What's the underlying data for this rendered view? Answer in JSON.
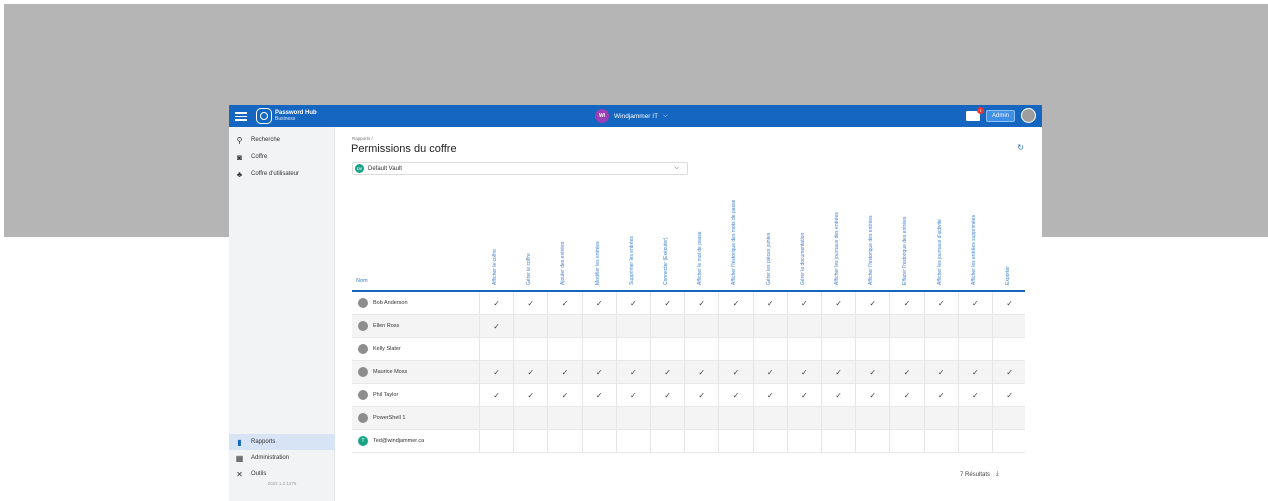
{
  "app": {
    "logo_title": "Password Hub",
    "logo_subtitle": "Business",
    "workspace": "Windjammer IT",
    "workspace_initials": "WI",
    "mail_badge": "1",
    "admin_label": "Admin",
    "brand_color": "#1566c0"
  },
  "sidebar": {
    "top_items": [
      {
        "label": "Recherche",
        "icon": "search-icon"
      },
      {
        "label": "Coffre",
        "icon": "vault-icon"
      },
      {
        "label": "Coffre d'utilisateur",
        "icon": "user-vault-icon"
      }
    ],
    "bottom_items": [
      {
        "label": "Rapports",
        "icon": "reports-icon",
        "active": true
      },
      {
        "label": "Administration",
        "icon": "admin-icon"
      },
      {
        "label": "Outils",
        "icon": "tools-icon"
      }
    ],
    "version": "2022.1.2.1275"
  },
  "page": {
    "breadcrumb": "Rapports  /",
    "title": "Permissions du coffre",
    "vault_select": "Default Vault",
    "vault_initials": "DV",
    "results": "7 Résultats"
  },
  "table": {
    "name_header": "Nom",
    "columns": [
      "Afficher le coffre",
      "Gérer le coffre",
      "Ajouter des entrées",
      "Modifier les entrées",
      "Supprimer les entrées",
      "Connecter (Exécuter)",
      "Afficher le mot de passe",
      "Afficher l'historique des mots de passe",
      "Gérer les pièces jointes",
      "Gérer la documentation",
      "Afficher les journaux des entrées",
      "Afficher l'historique des entrées",
      "Effacer l'historique des entrées",
      "Afficher les journaux d'activité",
      "Afficher les entrées supprimées",
      "Exporter"
    ],
    "check_glyph": "✓",
    "rows": [
      {
        "name": "Bob Anderson",
        "perms": [
          1,
          1,
          1,
          1,
          1,
          1,
          1,
          1,
          1,
          1,
          1,
          1,
          1,
          1,
          1,
          1
        ]
      },
      {
        "name": "Ellen Ross",
        "perms": [
          1,
          0,
          0,
          0,
          0,
          0,
          0,
          0,
          0,
          0,
          0,
          0,
          0,
          0,
          0,
          0
        ]
      },
      {
        "name": "Kelly Slater",
        "perms": [
          0,
          0,
          0,
          0,
          0,
          0,
          0,
          0,
          0,
          0,
          0,
          0,
          0,
          0,
          0,
          0
        ]
      },
      {
        "name": "Maurice Moss",
        "perms": [
          1,
          1,
          1,
          1,
          1,
          1,
          1,
          1,
          1,
          1,
          1,
          1,
          1,
          1,
          1,
          1
        ]
      },
      {
        "name": "Phil Taylor",
        "perms": [
          1,
          1,
          1,
          1,
          1,
          1,
          1,
          1,
          1,
          1,
          1,
          1,
          1,
          1,
          1,
          1
        ]
      },
      {
        "name": "PowerShell 1",
        "perms": [
          0,
          0,
          0,
          0,
          0,
          0,
          0,
          0,
          0,
          0,
          0,
          0,
          0,
          0,
          0,
          0
        ]
      },
      {
        "name": "Ted@windjammer.ca",
        "initial": "T",
        "perms": [
          0,
          0,
          0,
          0,
          0,
          0,
          0,
          0,
          0,
          0,
          0,
          0,
          0,
          0,
          0,
          0
        ]
      }
    ]
  }
}
